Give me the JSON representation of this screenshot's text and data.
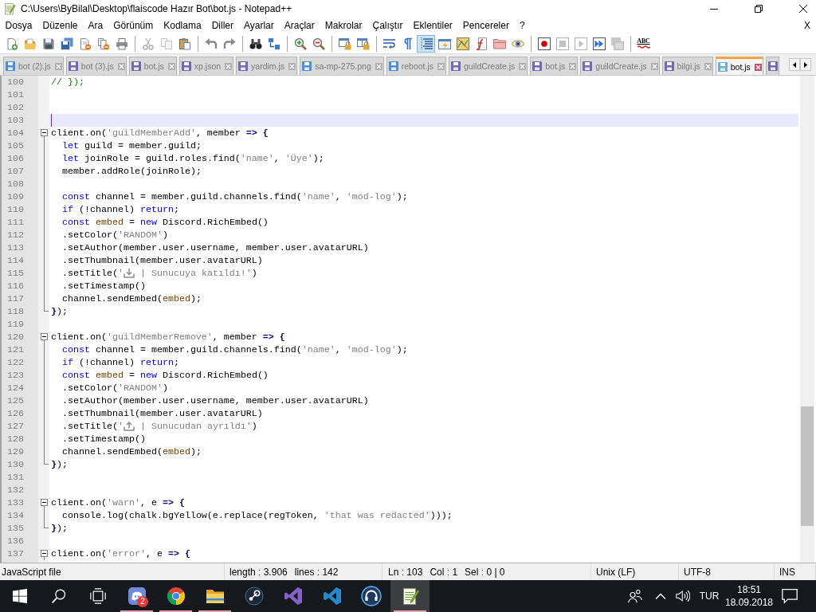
{
  "window": {
    "title": "C:\\Users\\ByBilal\\Desktop\\flaiscode Hazır Bot\\bot.js - Notepad++"
  },
  "menu": {
    "items": [
      "Dosya",
      "Düzenle",
      "Ara",
      "Görünüm",
      "Kodlama",
      "Diller",
      "Ayarlar",
      "Araçlar",
      "Makrolar",
      "Çalıştır",
      "Eklentiler",
      "Pencereler",
      "?"
    ],
    "close": "X"
  },
  "toolbar": [
    [
      {
        "kind": "new",
        "disabled": false,
        "pressed": false
      },
      {
        "kind": "open",
        "disabled": false,
        "pressed": false
      },
      {
        "kind": "save",
        "disabled": false,
        "pressed": false
      },
      {
        "kind": "save-all",
        "disabled": false,
        "pressed": false
      },
      {
        "kind": "close",
        "disabled": false,
        "pressed": false
      },
      {
        "kind": "close-all",
        "disabled": false,
        "pressed": false
      },
      {
        "kind": "print",
        "disabled": false,
        "pressed": false
      }
    ],
    [
      {
        "kind": "cut",
        "disabled": true,
        "pressed": false
      },
      {
        "kind": "copy",
        "disabled": true,
        "pressed": false
      },
      {
        "kind": "paste",
        "disabled": false,
        "pressed": false
      }
    ],
    [
      {
        "kind": "undo",
        "disabled": false,
        "pressed": false
      },
      {
        "kind": "redo",
        "disabled": false,
        "pressed": false
      }
    ],
    [
      {
        "kind": "find",
        "disabled": false,
        "pressed": false
      },
      {
        "kind": "replace",
        "disabled": false,
        "pressed": false
      }
    ],
    [
      {
        "kind": "zoom-in",
        "disabled": false,
        "pressed": false
      },
      {
        "kind": "zoom-out",
        "disabled": false,
        "pressed": false
      }
    ],
    [
      {
        "kind": "sync-vertical",
        "disabled": false,
        "pressed": false
      },
      {
        "kind": "sync-horizontal",
        "disabled": false,
        "pressed": false
      }
    ],
    [
      {
        "kind": "word-wrap",
        "disabled": false,
        "pressed": false
      },
      {
        "kind": "all-chars",
        "disabled": false,
        "pressed": false
      },
      {
        "kind": "indent-guide",
        "disabled": false,
        "pressed": true
      },
      {
        "kind": "language",
        "disabled": false,
        "pressed": false
      },
      {
        "kind": "doc-map",
        "disabled": false,
        "pressed": false
      },
      {
        "kind": "function-list",
        "disabled": false,
        "pressed": false
      },
      {
        "kind": "folder",
        "disabled": false,
        "pressed": false
      },
      {
        "kind": "monitor",
        "disabled": false,
        "pressed": false
      }
    ],
    [
      {
        "kind": "record",
        "disabled": false,
        "pressed": false
      },
      {
        "kind": "stop",
        "disabled": true,
        "pressed": false
      },
      {
        "kind": "play",
        "disabled": true,
        "pressed": false
      },
      {
        "kind": "play-multi",
        "disabled": false,
        "pressed": false
      },
      {
        "kind": "save-macro",
        "disabled": true,
        "pressed": false
      }
    ],
    [
      {
        "kind": "spellcheck",
        "label": "ABC",
        "disabled": false,
        "pressed": false
      }
    ]
  ],
  "tabs": [
    {
      "label": "bot (2).js",
      "selected": false,
      "color": "#4a8fd8"
    },
    {
      "label": "bot (3).js",
      "selected": false,
      "color": "#7468b4"
    },
    {
      "label": "bot.js",
      "selected": false,
      "color": "#7468b4"
    },
    {
      "label": "xp.json",
      "selected": false,
      "color": "#7468b4"
    },
    {
      "label": "yardim.js",
      "selected": false,
      "color": "#7468b4"
    },
    {
      "label": "sa-mp-275.png",
      "selected": false,
      "color": "#4a8fd8"
    },
    {
      "label": "reboot.js",
      "selected": false,
      "color": "#4a8fd8"
    },
    {
      "label": "guildCreate.js",
      "selected": false,
      "color": "#7468b4"
    },
    {
      "label": "bot.js",
      "selected": false,
      "color": "#7468b4"
    },
    {
      "label": "guildCreate.js",
      "selected": false,
      "color": "#7468b4"
    },
    {
      "label": "bilgi.js",
      "selected": false,
      "color": "#7468b4"
    },
    {
      "label": "bot.js",
      "selected": true,
      "color": "#6aaed8"
    },
    {
      "selected": false,
      "color": "#7468b4"
    }
  ],
  "editor": {
    "lines": [
      {
        "number": "100",
        "kind": "text",
        "current": false,
        "tokens": [
          {
            "kind": "comment",
            "text": "// });"
          }
        ]
      },
      {
        "number": "101",
        "kind": "text",
        "current": false
      },
      {
        "number": "102",
        "kind": "text",
        "current": false
      },
      {
        "number": "103",
        "kind": "text",
        "current": true
      },
      {
        "number": "104",
        "kind": "fold-open",
        "current": false,
        "tokens": [
          {
            "kind": "plain",
            "text": "client.on("
          },
          {
            "kind": "str",
            "text": "'guildMemberAdd'"
          },
          {
            "kind": "plain",
            "text": ", member "
          },
          {
            "kind": "op",
            "text": "=> {"
          }
        ]
      },
      {
        "number": "105",
        "kind": "fold-body",
        "current": false,
        "tokens": [
          {
            "kind": "kw",
            "text": "  let"
          },
          {
            "kind": "plain",
            "text": " guild = member.guild;"
          }
        ]
      },
      {
        "number": "106",
        "kind": "fold-body",
        "current": false,
        "tokens": [
          {
            "kind": "kw",
            "text": "  let"
          },
          {
            "kind": "plain",
            "text": " joinRole = guild.roles.find("
          },
          {
            "kind": "str",
            "text": "'name'"
          },
          {
            "kind": "plain",
            "text": ", "
          },
          {
            "kind": "str",
            "text": "'Üye'"
          },
          {
            "kind": "plain",
            "text": ");"
          }
        ]
      },
      {
        "number": "107",
        "kind": "fold-body",
        "current": false,
        "tokens": [
          {
            "kind": "plain",
            "text": "  member.addRole(joinRole);"
          }
        ]
      },
      {
        "number": "108",
        "kind": "fold-body",
        "current": false
      },
      {
        "number": "109",
        "kind": "fold-body",
        "current": false,
        "tokens": [
          {
            "kind": "kw",
            "text": "  const"
          },
          {
            "kind": "plain",
            "text": " channel = member.guild.channels.find("
          },
          {
            "kind": "str",
            "text": "'name'"
          },
          {
            "kind": "plain",
            "text": ", "
          },
          {
            "kind": "str",
            "text": "'mod-log'"
          },
          {
            "kind": "plain",
            "text": ");"
          }
        ]
      },
      {
        "number": "110",
        "kind": "fold-body",
        "current": false,
        "tokens": [
          {
            "kind": "kw",
            "text": "  if"
          },
          {
            "kind": "plain",
            "text": " (!channel) "
          },
          {
            "kind": "kw",
            "text": "return"
          },
          {
            "kind": "plain",
            "text": ";"
          }
        ]
      },
      {
        "number": "111",
        "kind": "fold-body",
        "current": false,
        "tokens": [
          {
            "kind": "kw",
            "text": "  const "
          },
          {
            "kind": "var",
            "text": "embed"
          },
          {
            "kind": "plain",
            "text": " = "
          },
          {
            "kind": "kw",
            "text": "new"
          },
          {
            "kind": "plain",
            "text": " Discord.RichEmbed()"
          }
        ]
      },
      {
        "number": "112",
        "kind": "fold-body",
        "current": false,
        "tokens": [
          {
            "kind": "plain",
            "text": "  .setColor("
          },
          {
            "kind": "str",
            "text": "'RANDOM'"
          },
          {
            "kind": "plain",
            "text": ")"
          }
        ]
      },
      {
        "number": "113",
        "kind": "fold-body",
        "current": false,
        "tokens": [
          {
            "kind": "plain",
            "text": "  .setAuthor(member.user.username, member.user.avatarURL)"
          }
        ]
      },
      {
        "number": "114",
        "kind": "fold-body",
        "current": false,
        "tokens": [
          {
            "kind": "plain",
            "text": "  .setThumbnail(member.user.avatarURL)"
          }
        ]
      },
      {
        "number": "115",
        "kind": "fold-body",
        "current": false,
        "tokens": [
          {
            "kind": "plain",
            "text": "  .setTitle("
          },
          {
            "kind": "str",
            "text": "'"
          },
          {
            "kind": "tray-in"
          },
          {
            "kind": "str",
            "text": " | Sunucuya katıldı!'"
          },
          {
            "kind": "plain",
            "text": ")"
          }
        ]
      },
      {
        "number": "116",
        "kind": "fold-body",
        "current": false,
        "tokens": [
          {
            "kind": "plain",
            "text": "  .setTimestamp()"
          }
        ]
      },
      {
        "number": "117",
        "kind": "fold-body",
        "current": false,
        "tokens": [
          {
            "kind": "plain",
            "text": "  channel.sendEmbed("
          },
          {
            "kind": "var",
            "text": "embed"
          },
          {
            "kind": "plain",
            "text": ");"
          }
        ]
      },
      {
        "number": "118",
        "kind": "fold-end",
        "current": false,
        "tokens": [
          {
            "kind": "op",
            "text": "}"
          },
          {
            "kind": "plain",
            "text": ");"
          }
        ]
      },
      {
        "number": "119",
        "kind": "text",
        "current": false
      },
      {
        "number": "120",
        "kind": "fold-open",
        "current": false,
        "tokens": [
          {
            "kind": "plain",
            "text": "client.on("
          },
          {
            "kind": "str",
            "text": "'guildMemberRemove'"
          },
          {
            "kind": "plain",
            "text": ", member "
          },
          {
            "kind": "op",
            "text": "=> {"
          }
        ]
      },
      {
        "number": "121",
        "kind": "fold-body",
        "current": false,
        "tokens": [
          {
            "kind": "kw",
            "text": "  const"
          },
          {
            "kind": "plain",
            "text": " channel = member.guild.channels.find("
          },
          {
            "kind": "str",
            "text": "'name'"
          },
          {
            "kind": "plain",
            "text": ", "
          },
          {
            "kind": "str",
            "text": "'mod-log'"
          },
          {
            "kind": "plain",
            "text": ");"
          }
        ]
      },
      {
        "number": "122",
        "kind": "fold-body",
        "current": false,
        "tokens": [
          {
            "kind": "kw",
            "text": "  if"
          },
          {
            "kind": "plain",
            "text": " (!channel) "
          },
          {
            "kind": "kw",
            "text": "return"
          },
          {
            "kind": "plain",
            "text": ";"
          }
        ]
      },
      {
        "number": "123",
        "kind": "fold-body",
        "current": false,
        "tokens": [
          {
            "kind": "kw",
            "text": "  const "
          },
          {
            "kind": "var",
            "text": "embed"
          },
          {
            "kind": "plain",
            "text": " = "
          },
          {
            "kind": "kw",
            "text": "new"
          },
          {
            "kind": "plain",
            "text": " Discord.RichEmbed()"
          }
        ]
      },
      {
        "number": "124",
        "kind": "fold-body",
        "current": false,
        "tokens": [
          {
            "kind": "plain",
            "text": "  .setColor("
          },
          {
            "kind": "str",
            "text": "'RANDOM'"
          },
          {
            "kind": "plain",
            "text": ")"
          }
        ]
      },
      {
        "number": "125",
        "kind": "fold-body",
        "current": false,
        "tokens": [
          {
            "kind": "plain",
            "text": "  .setAuthor(member.user.username, member.user.avatarURL)"
          }
        ]
      },
      {
        "number": "126",
        "kind": "fold-body",
        "current": false,
        "tokens": [
          {
            "kind": "plain",
            "text": "  .setThumbnail(member.user.avatarURL)"
          }
        ]
      },
      {
        "number": "127",
        "kind": "fold-body",
        "current": false,
        "tokens": [
          {
            "kind": "plain",
            "text": "  .setTitle("
          },
          {
            "kind": "str",
            "text": "'"
          },
          {
            "kind": "tray-out"
          },
          {
            "kind": "str",
            "text": " | Sunucudan ayrıldı'"
          },
          {
            "kind": "plain",
            "text": ")"
          }
        ]
      },
      {
        "number": "128",
        "kind": "fold-body",
        "current": false,
        "tokens": [
          {
            "kind": "plain",
            "text": "  .setTimestamp()"
          }
        ]
      },
      {
        "number": "129",
        "kind": "fold-body",
        "current": false,
        "tokens": [
          {
            "kind": "plain",
            "text": "  channel.sendEmbed("
          },
          {
            "kind": "var",
            "text": "embed"
          },
          {
            "kind": "plain",
            "text": ");"
          }
        ]
      },
      {
        "number": "130",
        "kind": "fold-end",
        "current": false,
        "tokens": [
          {
            "kind": "op",
            "text": "}"
          },
          {
            "kind": "plain",
            "text": ");"
          }
        ]
      },
      {
        "number": "131",
        "kind": "text",
        "current": false
      },
      {
        "number": "132",
        "kind": "text",
        "current": false
      },
      {
        "number": "133",
        "kind": "fold-open",
        "current": false,
        "tokens": [
          {
            "kind": "plain",
            "text": "client.on("
          },
          {
            "kind": "str",
            "text": "'warn'"
          },
          {
            "kind": "plain",
            "text": ", e "
          },
          {
            "kind": "op",
            "text": "=> {"
          }
        ]
      },
      {
        "number": "134",
        "kind": "fold-body",
        "current": false,
        "tokens": [
          {
            "kind": "plain",
            "text": "  console.log(chalk.bgYellow(e.replace(regToken, "
          },
          {
            "kind": "str",
            "text": "'that was redacted'"
          },
          {
            "kind": "plain",
            "text": ")));"
          }
        ]
      },
      {
        "number": "135",
        "kind": "fold-end",
        "current": false,
        "tokens": [
          {
            "kind": "op",
            "text": "}"
          },
          {
            "kind": "plain",
            "text": ");"
          }
        ]
      },
      {
        "number": "136",
        "kind": "text",
        "current": false
      },
      {
        "number": "137",
        "kind": "fold-open",
        "current": false,
        "tokens": [
          {
            "kind": "plain",
            "text": "client.on("
          },
          {
            "kind": "str",
            "text": "'error'"
          },
          {
            "kind": "plain",
            "text": ", e "
          },
          {
            "kind": "op",
            "text": "=> {"
          }
        ]
      }
    ]
  },
  "status_bar": {
    "file_type": "JavaScript file",
    "length": "length : 3.906",
    "lines": "lines : 142",
    "line": "Ln : 103",
    "column": "Col : 1",
    "selection": "Sel : 0 | 0",
    "line_ending": "Unix (LF)",
    "encoding": "UTF-8",
    "mode": "INS"
  },
  "taskbar": {
    "apps": [
      {
        "kind": "start",
        "running": false,
        "active": false
      },
      {
        "kind": "search",
        "running": false,
        "active": false
      },
      {
        "kind": "task-view",
        "running": false,
        "active": false
      },
      {
        "kind": "chat",
        "badge": "2",
        "running": true,
        "active": false
      },
      {
        "kind": "browser",
        "running": true,
        "active": false
      },
      {
        "kind": "file-folder",
        "running": true,
        "active": false
      },
      {
        "kind": "game-client",
        "running": false,
        "active": false
      },
      {
        "kind": "ide",
        "running": false,
        "active": false
      },
      {
        "kind": "code-editor",
        "running": false,
        "active": false
      },
      {
        "kind": "headset",
        "running": false,
        "active": false
      },
      {
        "kind": "notepad",
        "running": true,
        "active": true
      }
    ],
    "tray": {
      "language": "TUR",
      "time": "18:51",
      "date": "18.09.2018"
    }
  }
}
